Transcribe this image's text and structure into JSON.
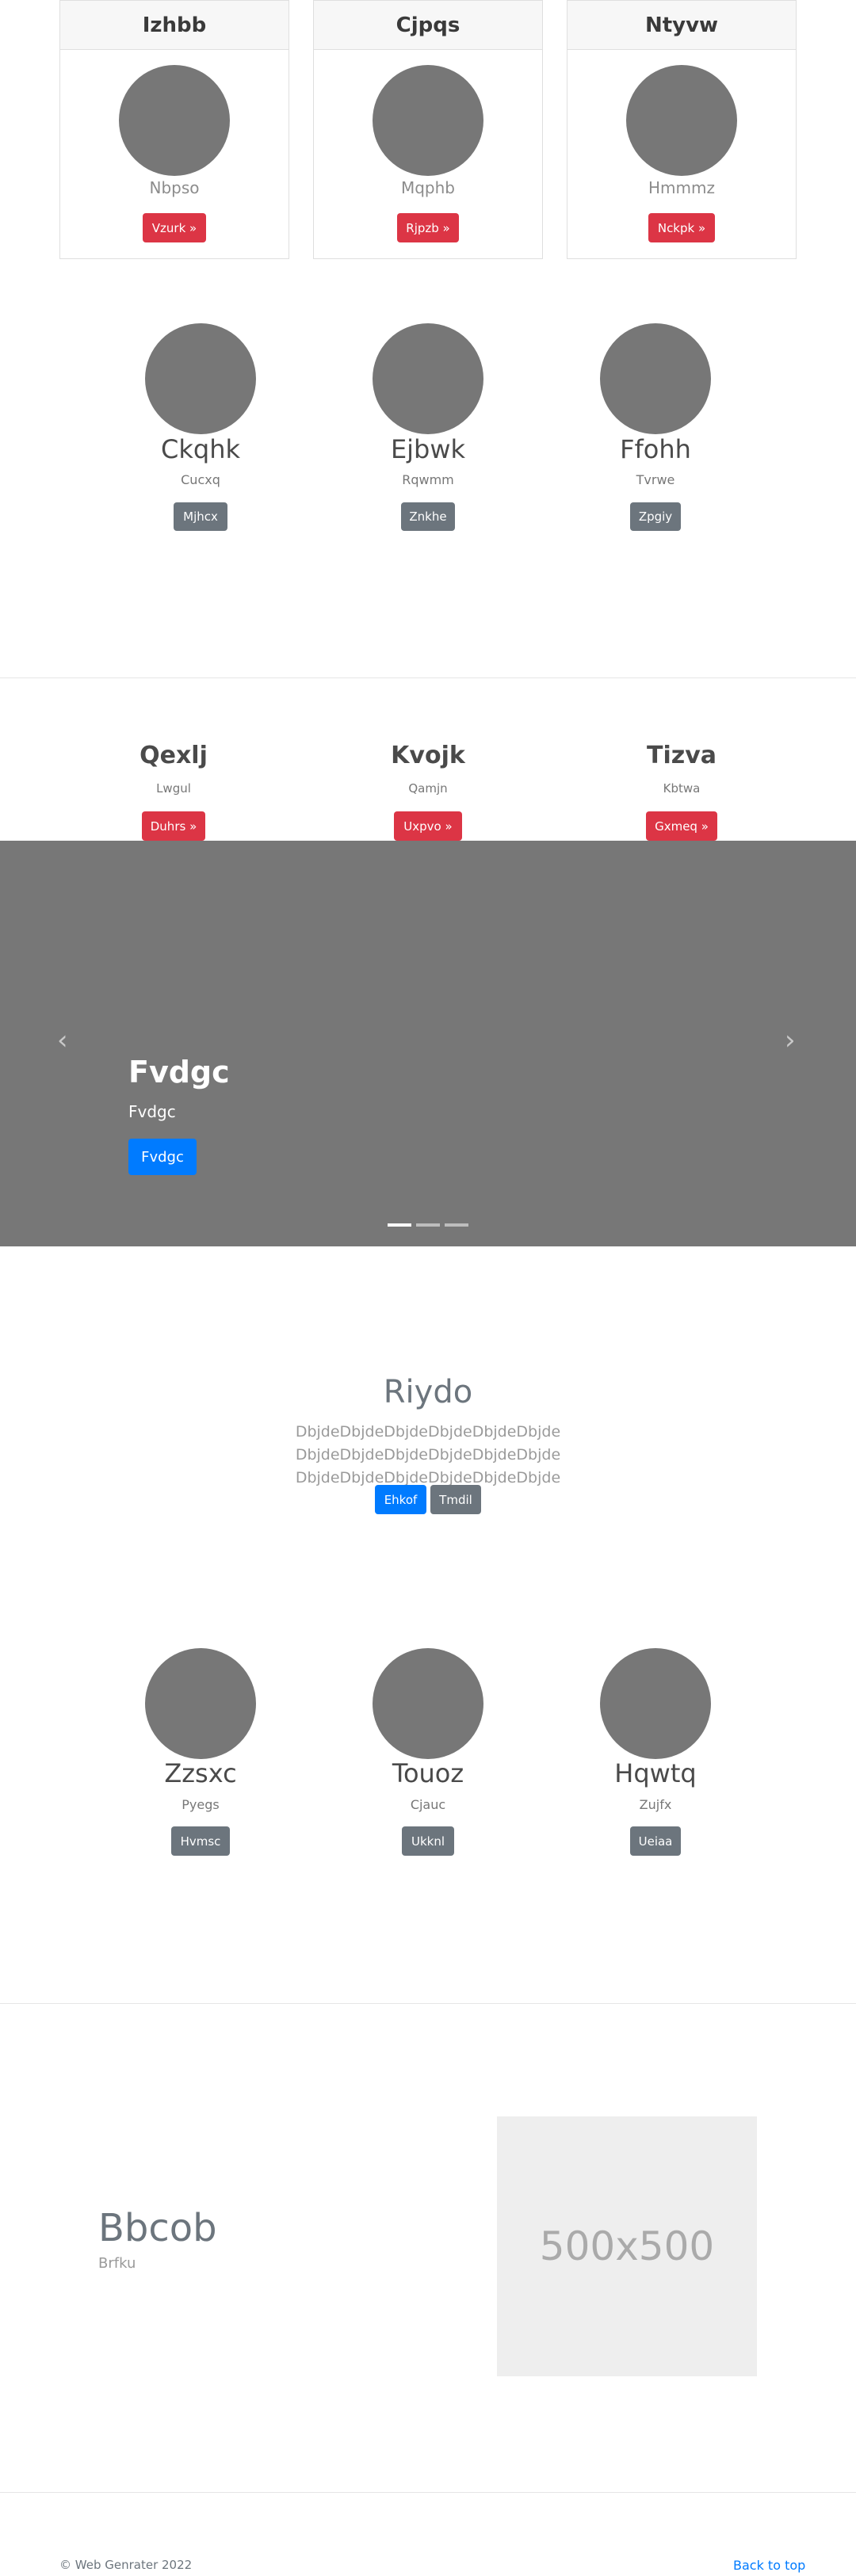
{
  "cards": [
    {
      "title": "Izhbb",
      "subtitle": "Nbpso",
      "button": "Vzurk »"
    },
    {
      "title": "Cjpqs",
      "subtitle": "Mqphb",
      "button": "Rjpzb »"
    },
    {
      "title": "Ntyvw",
      "subtitle": "Hmmmz",
      "button": "Nckpk »"
    }
  ],
  "team1": [
    {
      "name": "Ckqhk",
      "subtitle": "Cucxq",
      "button": "Mjhcx"
    },
    {
      "name": "Ejbwk",
      "subtitle": "Rqwmm",
      "button": "Znkhe"
    },
    {
      "name": "Ffohh",
      "subtitle": "Tvrwe",
      "button": "Zpgiy"
    }
  ],
  "team2": [
    {
      "name": "Qexlj",
      "subtitle": "Lwgul",
      "button": "Duhrs »"
    },
    {
      "name": "Kvojk",
      "subtitle": "Qamjn",
      "button": "Uxpvo »"
    },
    {
      "name": "Tizva",
      "subtitle": "Kbtwa",
      "button": "Gxmeq »"
    }
  ],
  "carousel": {
    "title": "Fvdgc",
    "subtitle": "Fvdgc",
    "button": "Fvdgc",
    "prev_icon": "chevron-left-icon",
    "next_icon": "chevron-right-icon",
    "prev_glyph": "‹",
    "next_glyph": "›",
    "slide_count": 3,
    "active_index": 0
  },
  "hero": {
    "title": "Riydo",
    "text": "DbjdeDbjdeDbjdeDbjdeDbjdeDbjde DbjdeDbjdeDbjdeDbjdeDbjdeDbjde DbjdeDbjdeDbjdeDbjdeDbjdeDbjde",
    "primary_button": "Ehkof",
    "secondary_button": "Tmdil"
  },
  "team3": [
    {
      "name": "Zzsxc",
      "subtitle": "Pyegs",
      "button": "Hvmsc"
    },
    {
      "name": "Touoz",
      "subtitle": "Cjauc",
      "button": "Ukknl"
    },
    {
      "name": "Hqwtq",
      "subtitle": "Zujfx",
      "button": "Ueiaa"
    }
  ],
  "feature": {
    "title": "Bbcob",
    "subtitle": "Brfku",
    "image_label": "500x500"
  },
  "footer": {
    "copyright": "© Web Genrater 2022",
    "back_to_top": "Back to top"
  },
  "colors": {
    "red": "#dc3545",
    "gray": "#6c757d",
    "blue": "#007bff",
    "placeholder": "#777777"
  }
}
